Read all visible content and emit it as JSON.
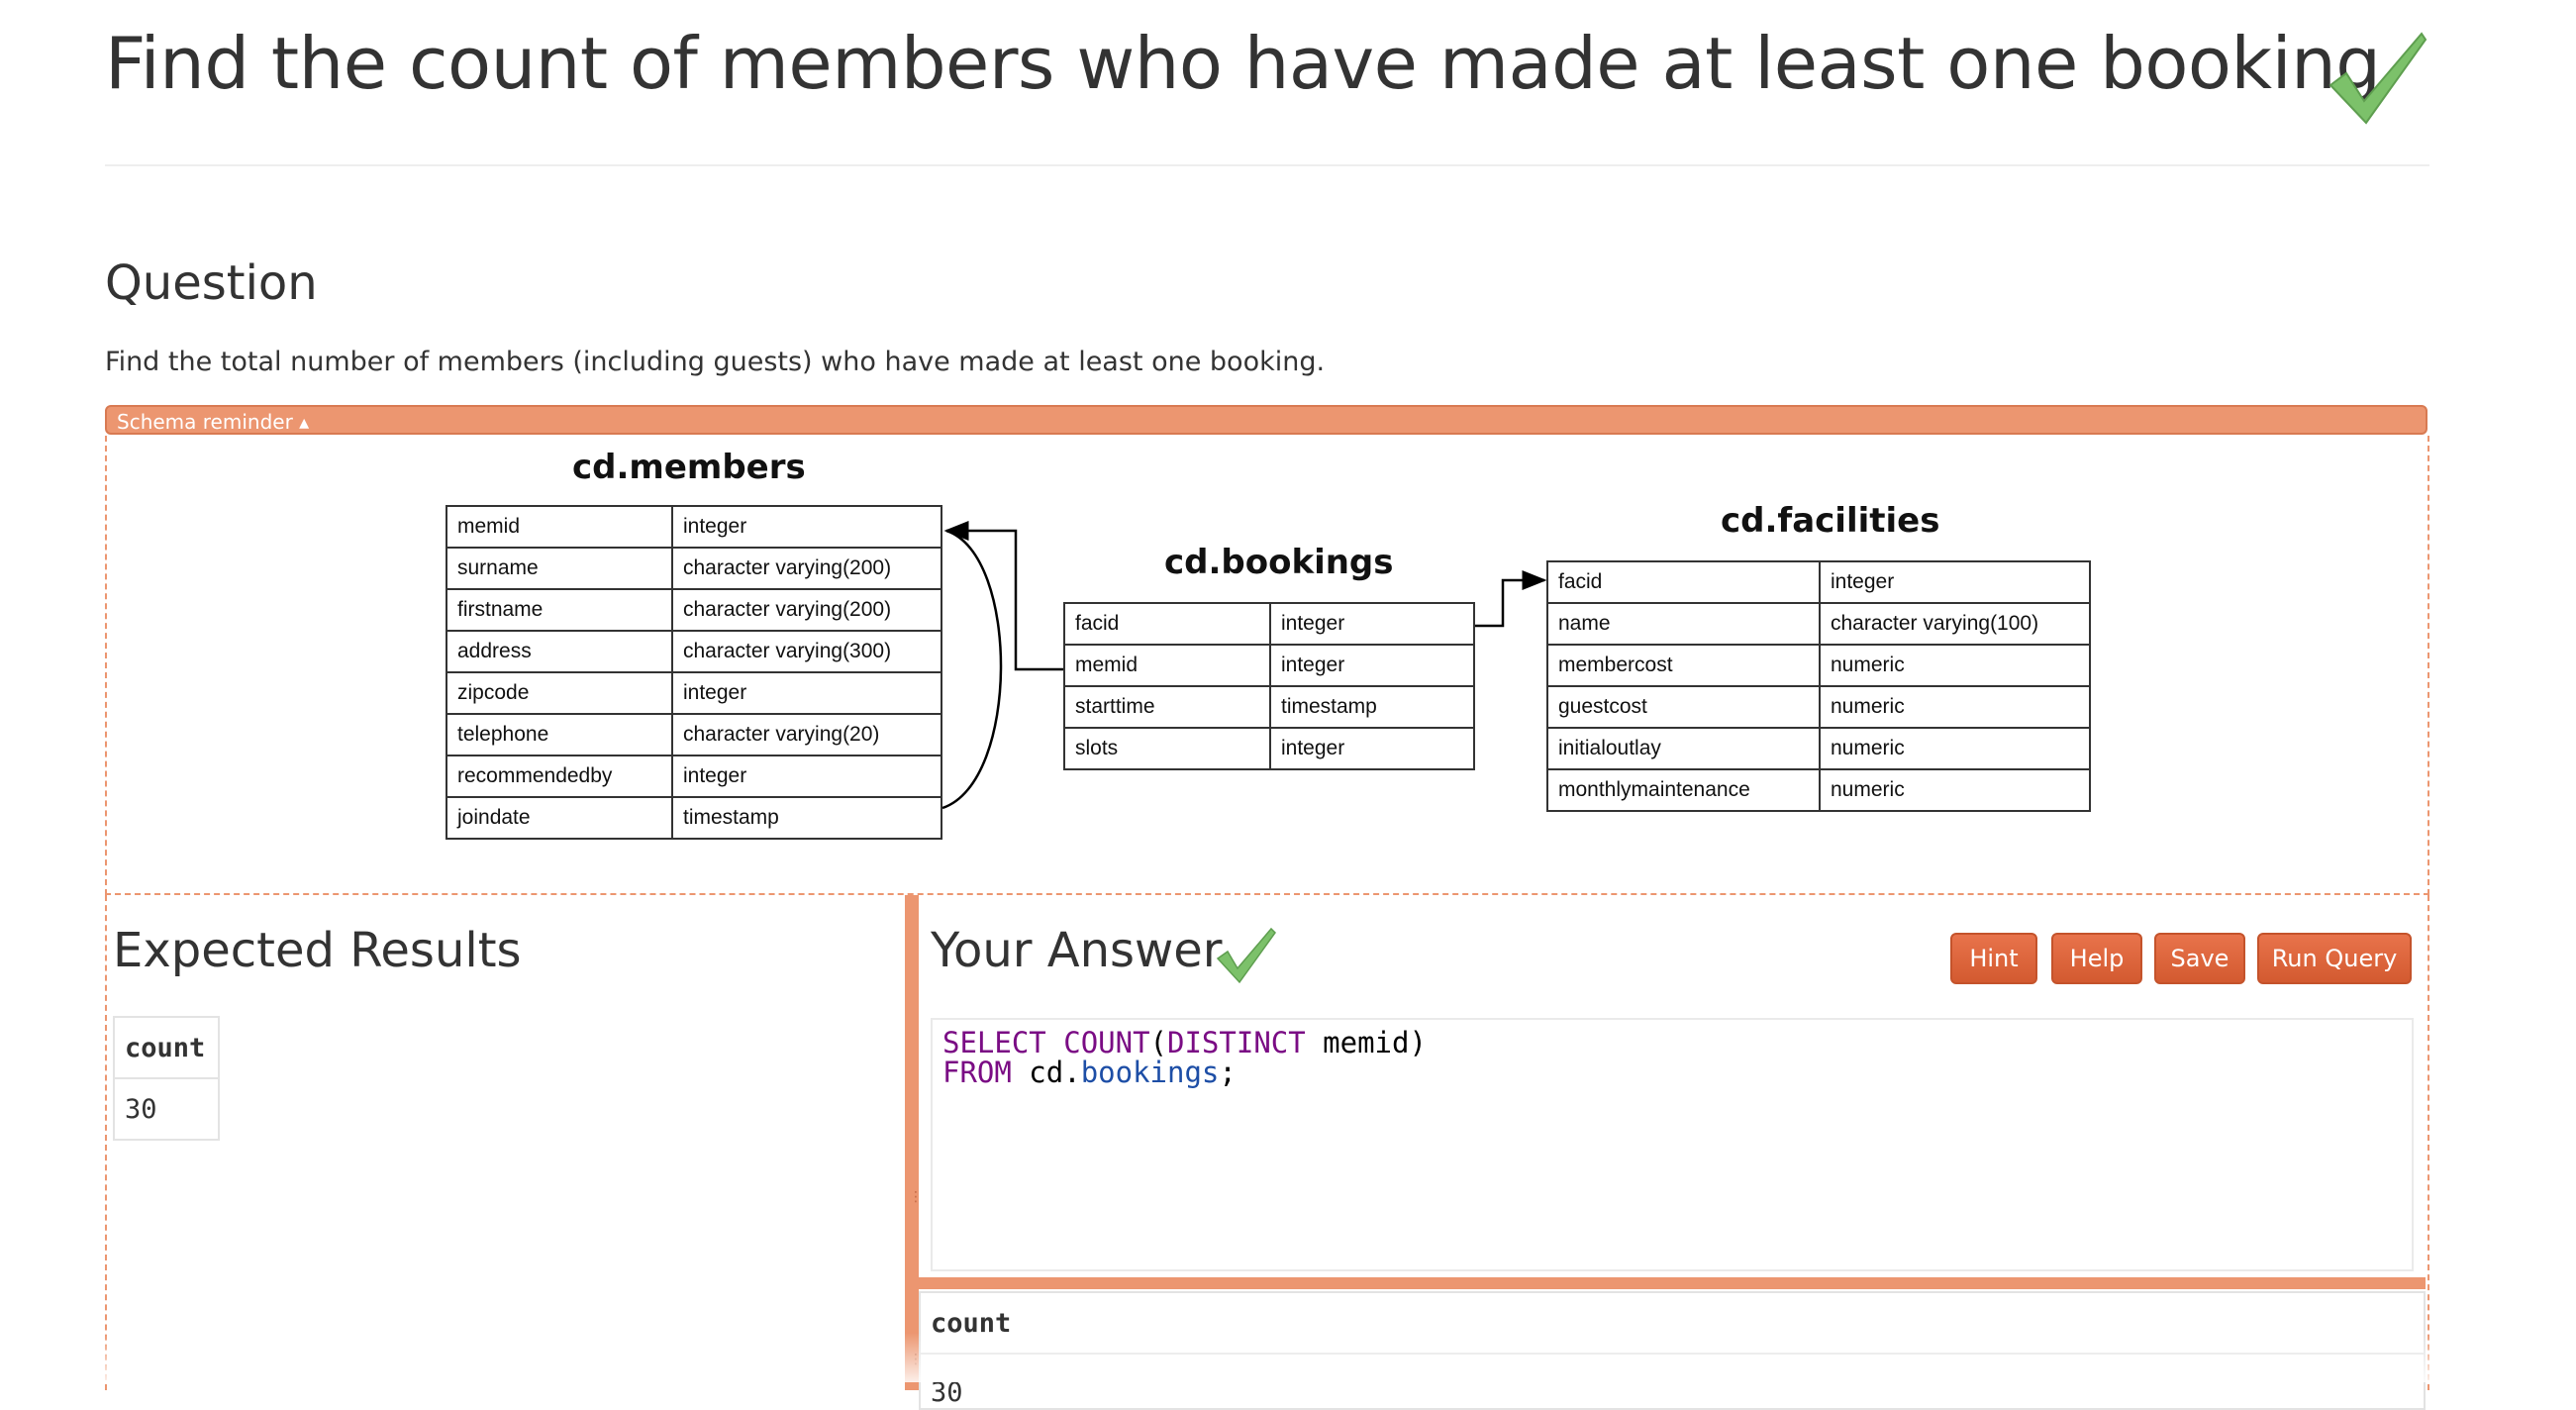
{
  "page": {
    "title": "Find the count of members who have made at least one booking",
    "question_heading": "Question",
    "question_text": "Find the total number of members (including guests) who have made at least one booking."
  },
  "schema": {
    "toggle_label": "Schema reminder ▴",
    "tables": {
      "members": {
        "title": "cd.members",
        "rows": [
          {
            "column": "memid",
            "type": "integer"
          },
          {
            "column": "surname",
            "type": "character varying(200)"
          },
          {
            "column": "firstname",
            "type": "character varying(200)"
          },
          {
            "column": "address",
            "type": "character varying(300)"
          },
          {
            "column": "zipcode",
            "type": "integer"
          },
          {
            "column": "telephone",
            "type": "character varying(20)"
          },
          {
            "column": "recommendedby",
            "type": "integer"
          },
          {
            "column": "joindate",
            "type": "timestamp"
          }
        ]
      },
      "bookings": {
        "title": "cd.bookings",
        "rows": [
          {
            "column": "facid",
            "type": "integer"
          },
          {
            "column": "memid",
            "type": "integer"
          },
          {
            "column": "starttime",
            "type": "timestamp"
          },
          {
            "column": "slots",
            "type": "integer"
          }
        ]
      },
      "facilities": {
        "title": "cd.facilities",
        "rows": [
          {
            "column": "facid",
            "type": "integer"
          },
          {
            "column": "name",
            "type": "character varying(100)"
          },
          {
            "column": "membercost",
            "type": "numeric"
          },
          {
            "column": "guestcost",
            "type": "numeric"
          },
          {
            "column": "initialoutlay",
            "type": "numeric"
          },
          {
            "column": "monthlymaintenance",
            "type": "numeric"
          }
        ]
      }
    }
  },
  "expected": {
    "heading": "Expected Results",
    "columns": [
      "count"
    ],
    "rows": [
      [
        "30"
      ]
    ]
  },
  "answer": {
    "heading": "Your Answer",
    "buttons": {
      "hint": "Hint",
      "help": "Help",
      "save": "Save",
      "run": "Run Query"
    },
    "sql_tokens": {
      "select": "SELECT",
      "count": "COUNT",
      "open_paren": "(",
      "distinct": "DISTINCT",
      "column": " memid)",
      "from": "FROM",
      "schema_prefix": " cd.",
      "table": "bookings",
      "terminator": ";"
    },
    "result": {
      "columns": [
        "count"
      ],
      "rows": [
        [
          "30"
        ]
      ]
    }
  },
  "colors": {
    "accent": "#ec9670",
    "button": "#d35a30",
    "check": "#7cc16a",
    "keyword": "#7a0c84",
    "table_name": "#1d4ea6"
  },
  "icons": {
    "status": "check-icon"
  }
}
